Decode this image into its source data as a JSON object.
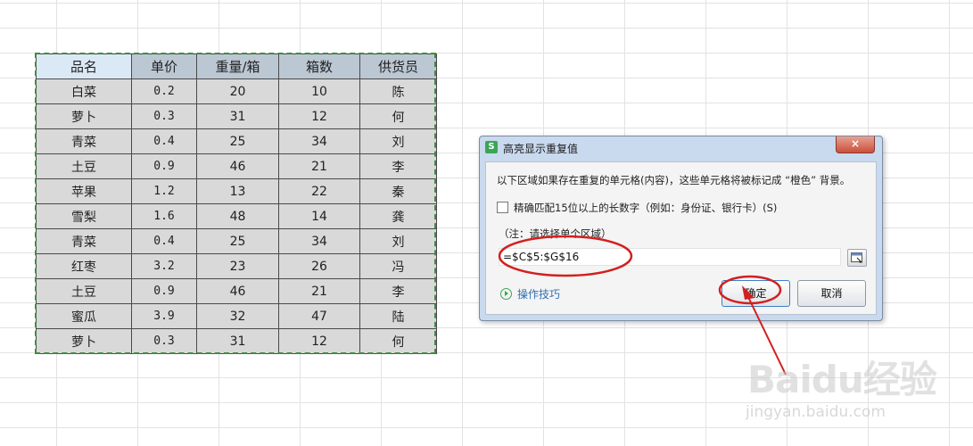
{
  "sheet": {
    "headers": [
      "品名",
      "单价",
      "重量/箱",
      "箱数",
      "供货员"
    ],
    "rows": [
      [
        "白菜",
        "0.2",
        "20",
        "10",
        "陈"
      ],
      [
        "萝卜",
        "0.3",
        "31",
        "12",
        "何"
      ],
      [
        "青菜",
        "0.4",
        "25",
        "34",
        "刘"
      ],
      [
        "土豆",
        "0.9",
        "46",
        "21",
        "李"
      ],
      [
        "苹果",
        "1.2",
        "13",
        "22",
        "秦"
      ],
      [
        "雪梨",
        "1.6",
        "48",
        "14",
        "龚"
      ],
      [
        "青菜",
        "0.4",
        "25",
        "34",
        "刘"
      ],
      [
        "红枣",
        "3.2",
        "23",
        "26",
        "冯"
      ],
      [
        "土豆",
        "0.9",
        "46",
        "21",
        "李"
      ],
      [
        "蜜瓜",
        "3.9",
        "32",
        "47",
        "陆"
      ],
      [
        "萝卜",
        "0.3",
        "31",
        "12",
        "何"
      ]
    ]
  },
  "dialog": {
    "app_icon": "S",
    "title": "高亮显示重复值",
    "close_label": "×",
    "description": "以下区域如果存在重复的单元格(内容)，这些单元格将被标记成 “橙色” 背景。",
    "checkbox_label": "精确匹配15位以上的长数字（例如：身份证、银行卡）(S)",
    "checkbox_checked": false,
    "note": "（注：请选择单个区域）",
    "range_value": "=$C$5:$G$16",
    "range_picker_icon": "range-select-icon",
    "tips_label": "操作技巧",
    "ok_label": "确定",
    "cancel_label": "取消"
  },
  "watermark": {
    "text": "Baidu经验",
    "url": "jingyan.baidu.com"
  },
  "colors": {
    "annotation": "#d22020",
    "selection_border": "#3d8d3d",
    "header_bg": "#bcc7d4",
    "cell_bg": "#d9d9d9"
  }
}
